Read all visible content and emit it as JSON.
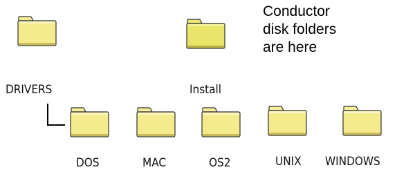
{
  "annotation": {
    "text": "Conductor\ndisk folders\nare here"
  },
  "folders": {
    "drivers": {
      "label": "DRIVERS",
      "icon": "folder-icon"
    },
    "install": {
      "label": "Install",
      "icon": "folder-icon"
    },
    "dos": {
      "label": "DOS",
      "icon": "folder-icon"
    },
    "mac": {
      "label": "MAC",
      "icon": "folder-icon"
    },
    "os2": {
      "label": "OS2",
      "icon": "folder-icon"
    },
    "unix": {
      "label": "UNIX",
      "icon": "folder-icon"
    },
    "windows": {
      "label": "WINDOWS",
      "icon": "folder-icon"
    }
  },
  "colors": {
    "folder_fill": "#f4eb8c",
    "folder_dark": "#b8a84c",
    "install_fill": "#e9e56a",
    "outline": "#303030",
    "connector": "#000000"
  }
}
